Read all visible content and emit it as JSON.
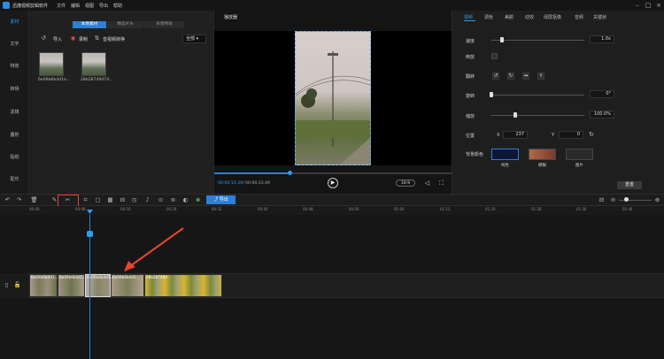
{
  "app": {
    "title": "迅捷视频剪辑软件",
    "menu": [
      "文件",
      "编辑",
      "视图",
      "导出",
      "帮助"
    ]
  },
  "nav": {
    "items": [
      "素材",
      "文字",
      "特效",
      "转场",
      "滤镜",
      "叠附",
      "贴纸",
      "配乐"
    ]
  },
  "media": {
    "tabs": [
      "本地素材",
      "精选片头",
      "背景特效"
    ],
    "import_label": "导入",
    "record_label": "录制",
    "convert_label": "音视频转换",
    "filter_value": "全部",
    "files": [
      {
        "name": "6e09b6b4d1e..."
      },
      {
        "name": "28b28749474..."
      }
    ]
  },
  "player": {
    "label": "播放器",
    "current_time": "00:00:10.39",
    "total_time": "/ 00:00:33.49",
    "ratio": "16:9",
    "progress": 0.32
  },
  "props": {
    "tabs": [
      "视频",
      "调色",
      "美颜",
      "动效",
      "绿屏抠像",
      "音频",
      "关键帧"
    ],
    "speed_label": "速度",
    "speed_value": "1.0x",
    "reverse_label": "倒放",
    "flip_label": "翻转",
    "rotate_label": "旋转",
    "rotate_value": "0°",
    "scale_label": "缩放",
    "scale_value": "100.0%",
    "position_label": "位置",
    "pos_x_label": "X",
    "pos_x": "237",
    "pos_y_label": "Y",
    "pos_y": "0",
    "bg_label": "背景颜色",
    "bg_options": [
      "纯色",
      "模糊",
      "图片"
    ],
    "reset_label": "重置",
    "colors": {
      "solid": "#0f1635",
      "blur": "#a0563e",
      "image": "#2a2a2a"
    }
  },
  "toolbar": {
    "export_label": "导出"
  },
  "ruler": {
    "ticks": [
      "00:00",
      "00:08",
      "00:16",
      "00:24",
      "00:32",
      "00:40",
      "00:48",
      "00:56",
      "01:04",
      "01:12",
      "01:20",
      "01:28",
      "01:36",
      "01:44"
    ]
  },
  "clips": [
    {
      "label": "6e09b6b4d1..."
    },
    {
      "label": "6e09b6b4d1..."
    },
    {
      "label": "6e09b6b4d1..."
    },
    {
      "label": "6e09b6b4d1..."
    },
    {
      "label": "28b287494..."
    }
  ]
}
